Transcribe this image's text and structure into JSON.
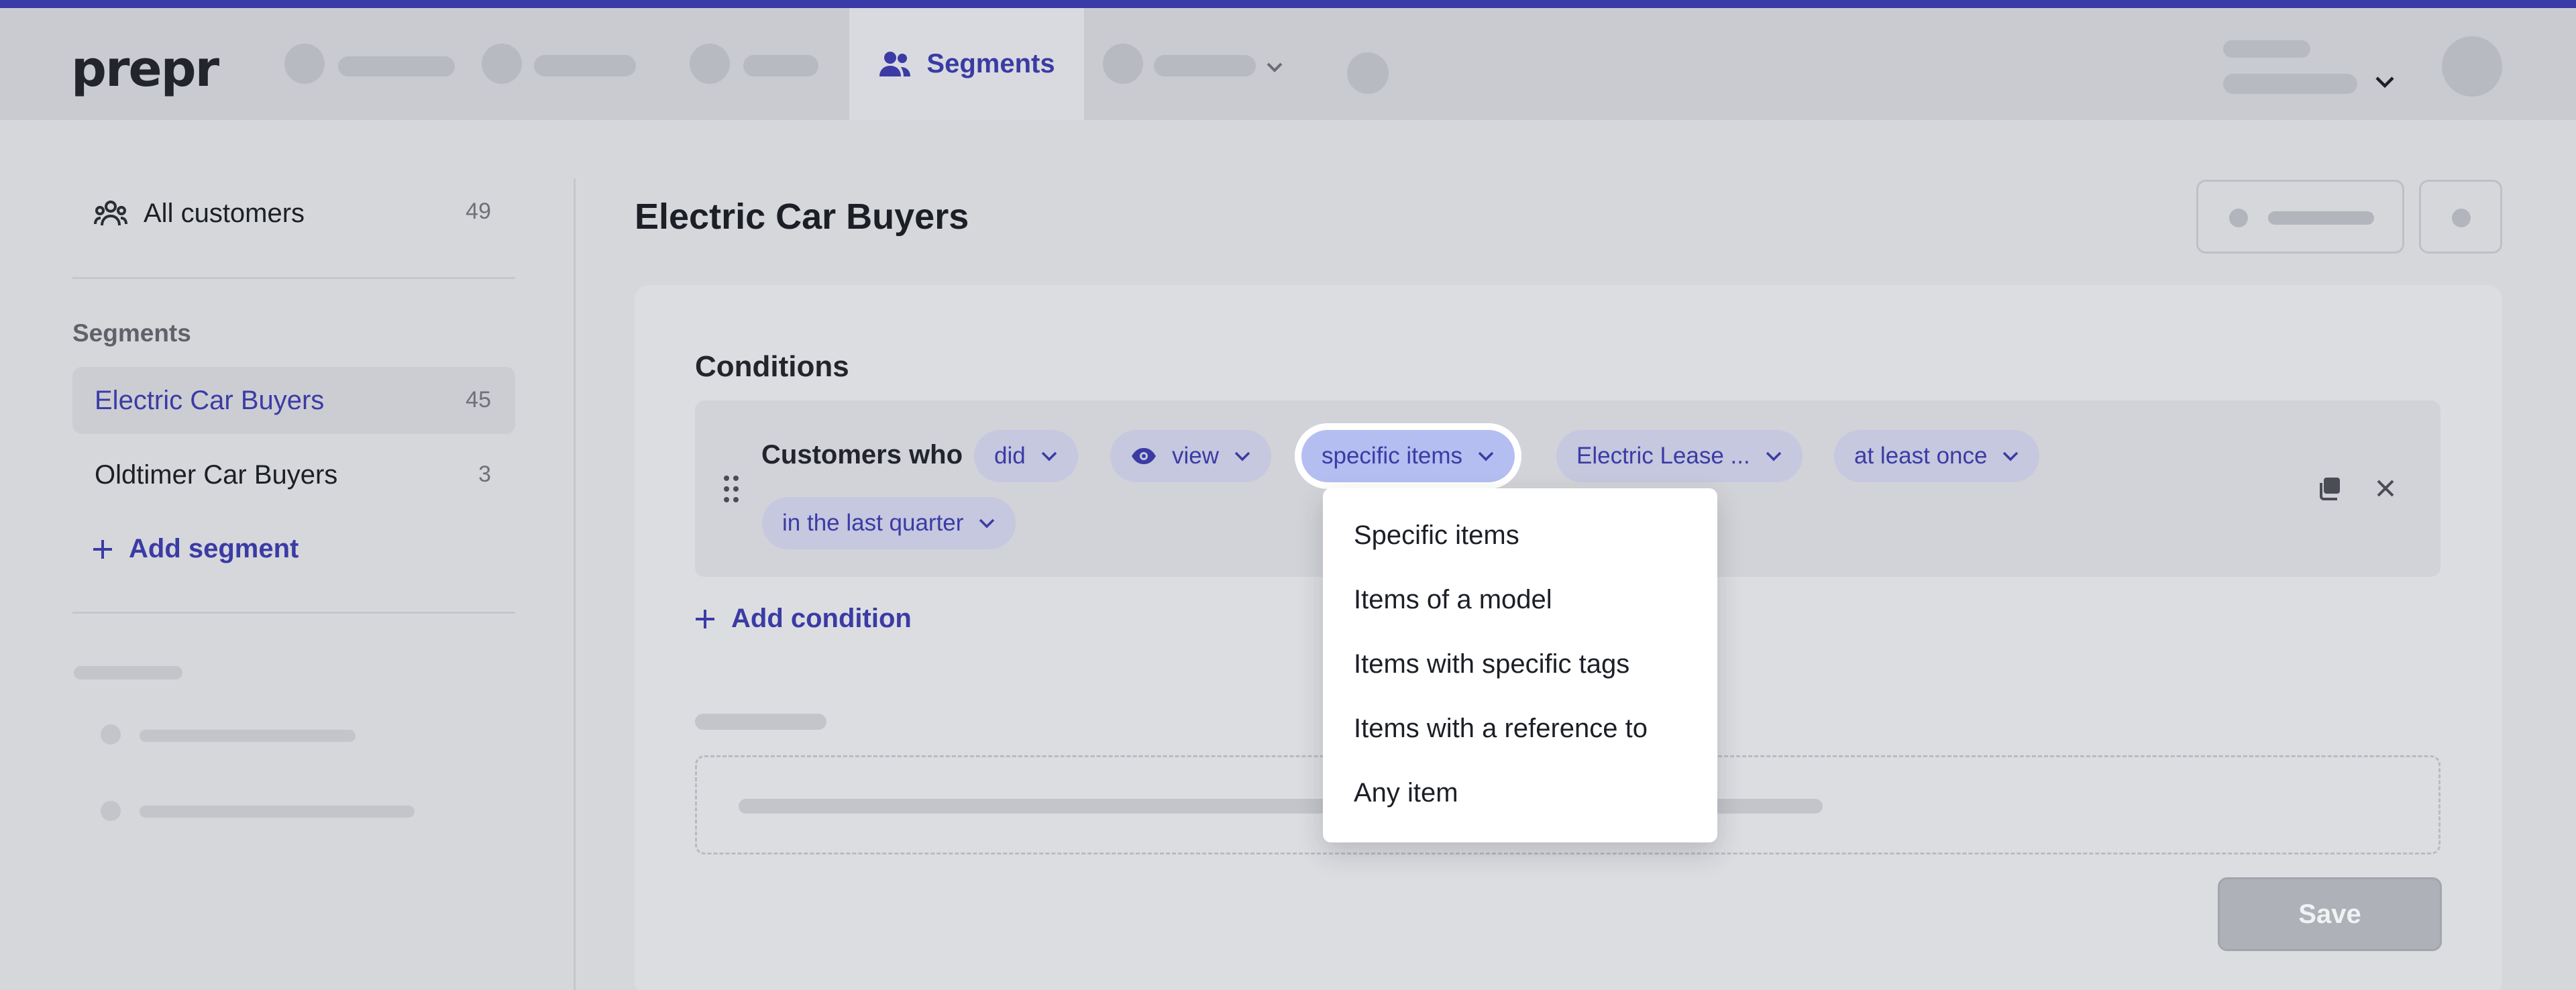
{
  "brand": {
    "logo": "prepr"
  },
  "nav": {
    "active_label": "Segments"
  },
  "sidebar": {
    "all_customers": {
      "label": "All customers",
      "count": "49"
    },
    "section_title": "Segments",
    "items": [
      {
        "label": "Electric Car Buyers",
        "count": "45",
        "selected": true
      },
      {
        "label": "Oldtimer Car Buyers",
        "count": "3",
        "selected": false
      }
    ],
    "add_segment": "Add segment"
  },
  "main": {
    "title": "Electric Car Buyers",
    "conditions_title": "Conditions",
    "condition": {
      "prefix": "Customers who",
      "pills": [
        "did",
        "view",
        "specific items",
        "Electric Lease ...",
        "at least once",
        "in the last quarter"
      ]
    },
    "add_condition": "Add condition",
    "save_label": "Save"
  },
  "dropdown": {
    "options": [
      "Specific items",
      "Items of a model",
      "Items with specific tags",
      "Items with a reference to",
      "Any item"
    ]
  },
  "colors": {
    "accent": "#3b3ba5",
    "top_line": "#3a3aa8",
    "pill_bg": "#c5c8de",
    "pill_active_bg": "#b5bef0"
  }
}
